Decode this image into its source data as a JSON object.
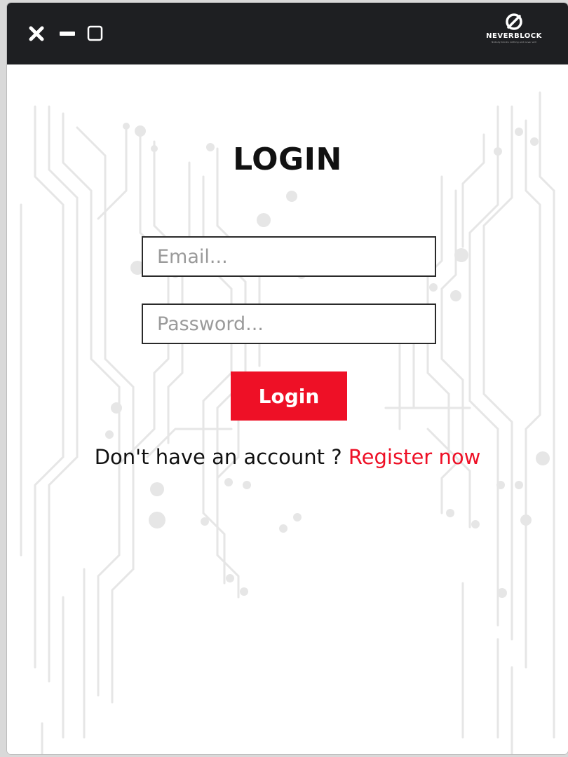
{
  "window": {
    "controls": {
      "close_icon": "close-icon",
      "minimize_icon": "minimize-icon",
      "maximize_icon": "maximize-icon"
    },
    "logo": {
      "name": "NEVERBLOCK",
      "tagline": "Nobody blocks nothing and never will",
      "icon": "neverblock-logo-icon"
    }
  },
  "login": {
    "title": "LOGIN",
    "email_placeholder": "Email...",
    "password_placeholder": "Password...",
    "submit_label": "Login",
    "register_prompt": "Don't have an account ?",
    "register_link": "Register now"
  },
  "colors": {
    "accent": "#ee1026",
    "titlebar": "#1e1f22",
    "background": "#ffffff",
    "circuit": "#e8e8e8"
  }
}
